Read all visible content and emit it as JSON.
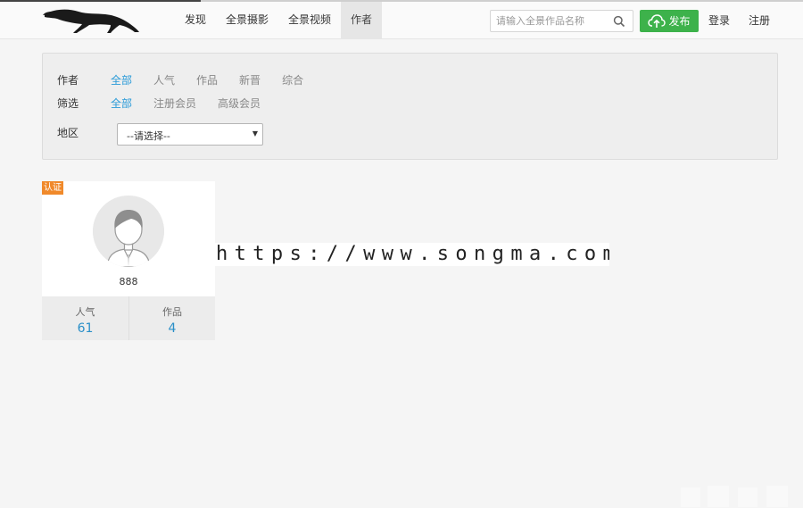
{
  "header": {
    "nav": [
      {
        "label": "发现",
        "active": false
      },
      {
        "label": "全景摄影",
        "active": false
      },
      {
        "label": "全景视频",
        "active": false
      },
      {
        "label": "作者",
        "active": true
      }
    ],
    "search_placeholder": "请输入全景作品名称",
    "publish_label": "发布",
    "login_label": "登录",
    "register_label": "注册"
  },
  "filter": {
    "author_label": "作者",
    "author_options": [
      "全部",
      "人气",
      "作品",
      "新晋",
      "综合"
    ],
    "screen_label": "筛选",
    "screen_options": [
      "全部",
      "注册会员",
      "高级会员"
    ],
    "region_label": "地区",
    "region_selected": "--请选择--"
  },
  "authors": [
    {
      "badge": "认证",
      "name": "888",
      "popularity_label": "人气",
      "popularity": "61",
      "works_label": "作品",
      "works": "4"
    }
  ],
  "watermark": "https://www.songma.com",
  "colors": {
    "accent_blue": "#2a9bd8",
    "publish_green": "#3db24b",
    "badge_orange": "#f0892a"
  }
}
